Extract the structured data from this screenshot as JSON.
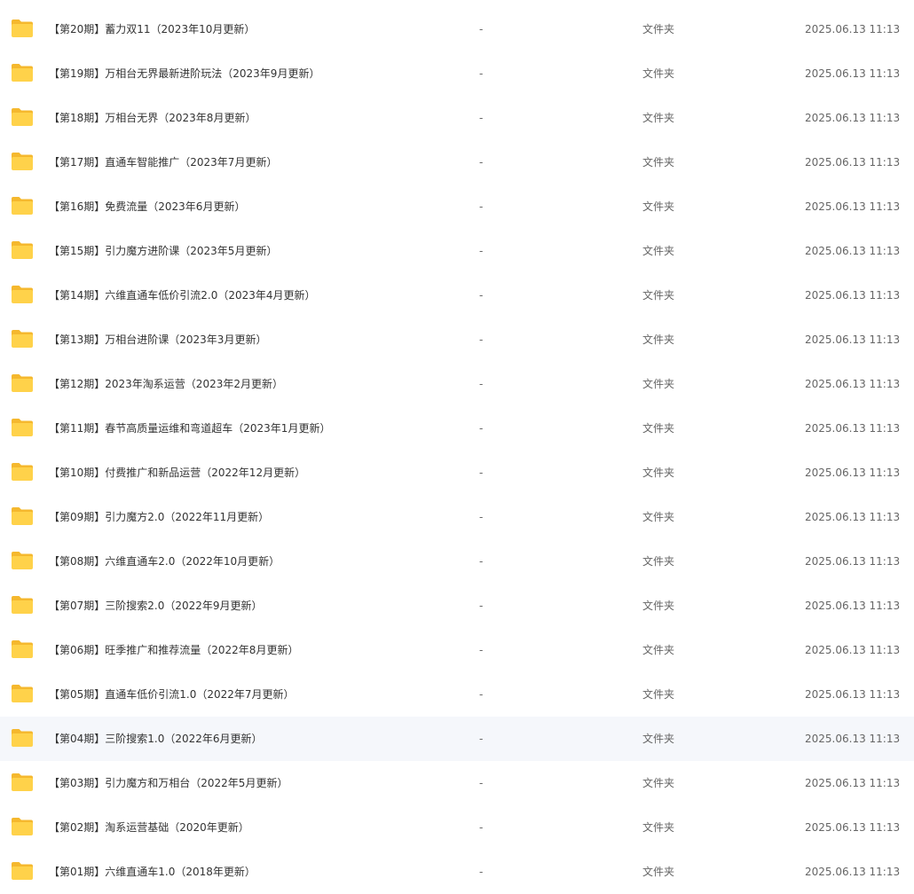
{
  "files": [
    {
      "name": "【第20期】蓄力双11（2023年10月更新）",
      "size": "-",
      "type": "文件夹",
      "modified": "2025.06.13 11:13"
    },
    {
      "name": "【第19期】万相台无界最新进阶玩法（2023年9月更新）",
      "size": "-",
      "type": "文件夹",
      "modified": "2025.06.13 11:13"
    },
    {
      "name": "【第18期】万相台无界（2023年8月更新）",
      "size": "-",
      "type": "文件夹",
      "modified": "2025.06.13 11:13"
    },
    {
      "name": "【第17期】直通车智能推广（2023年7月更新）",
      "size": "-",
      "type": "文件夹",
      "modified": "2025.06.13 11:13"
    },
    {
      "name": "【第16期】免费流量（2023年6月更新）",
      "size": "-",
      "type": "文件夹",
      "modified": "2025.06.13 11:13"
    },
    {
      "name": "【第15期】引力魔方进阶课（2023年5月更新）",
      "size": "-",
      "type": "文件夹",
      "modified": "2025.06.13 11:13"
    },
    {
      "name": "【第14期】六维直通车低价引流2.0（2023年4月更新）",
      "size": "-",
      "type": "文件夹",
      "modified": "2025.06.13 11:13"
    },
    {
      "name": "【第13期】万相台进阶课（2023年3月更新）",
      "size": "-",
      "type": "文件夹",
      "modified": "2025.06.13 11:13"
    },
    {
      "name": "【第12期】2023年淘系运营（2023年2月更新）",
      "size": "-",
      "type": "文件夹",
      "modified": "2025.06.13 11:13"
    },
    {
      "name": "【第11期】春节高质量运维和弯道超车（2023年1月更新）",
      "size": "-",
      "type": "文件夹",
      "modified": "2025.06.13 11:13"
    },
    {
      "name": "【第10期】付费推广和新品运营（2022年12月更新）",
      "size": "-",
      "type": "文件夹",
      "modified": "2025.06.13 11:13"
    },
    {
      "name": "【第09期】引力魔方2.0（2022年11月更新）",
      "size": "-",
      "type": "文件夹",
      "modified": "2025.06.13 11:13"
    },
    {
      "name": "【第08期】六维直通车2.0（2022年10月更新）",
      "size": "-",
      "type": "文件夹",
      "modified": "2025.06.13 11:13"
    },
    {
      "name": "【第07期】三阶搜索2.0（2022年9月更新）",
      "size": "-",
      "type": "文件夹",
      "modified": "2025.06.13 11:13"
    },
    {
      "name": "【第06期】旺季推广和推荐流量（2022年8月更新）",
      "size": "-",
      "type": "文件夹",
      "modified": "2025.06.13 11:13"
    },
    {
      "name": "【第05期】直通车低价引流1.0（2022年7月更新）",
      "size": "-",
      "type": "文件夹",
      "modified": "2025.06.13 11:13"
    },
    {
      "name": "【第04期】三阶搜索1.0（2022年6月更新）",
      "size": "-",
      "type": "文件夹",
      "modified": "2025.06.13 11:13"
    },
    {
      "name": "【第03期】引力魔方和万相台（2022年5月更新）",
      "size": "-",
      "type": "文件夹",
      "modified": "2025.06.13 11:13"
    },
    {
      "name": "【第02期】淘系运营基础（2020年更新）",
      "size": "-",
      "type": "文件夹",
      "modified": "2025.06.13 11:13"
    },
    {
      "name": "【第01期】六维直通车1.0（2018年更新）",
      "size": "-",
      "type": "文件夹",
      "modified": "2025.06.13 11:13"
    }
  ],
  "hovered_row": 16,
  "icon": "folder-icon",
  "colors": {
    "folder_body": "#ffd24a",
    "folder_tab": "#f5b82e",
    "hover_bg": "#f5f7fb",
    "text": "#333333",
    "muted_text": "#666666"
  }
}
